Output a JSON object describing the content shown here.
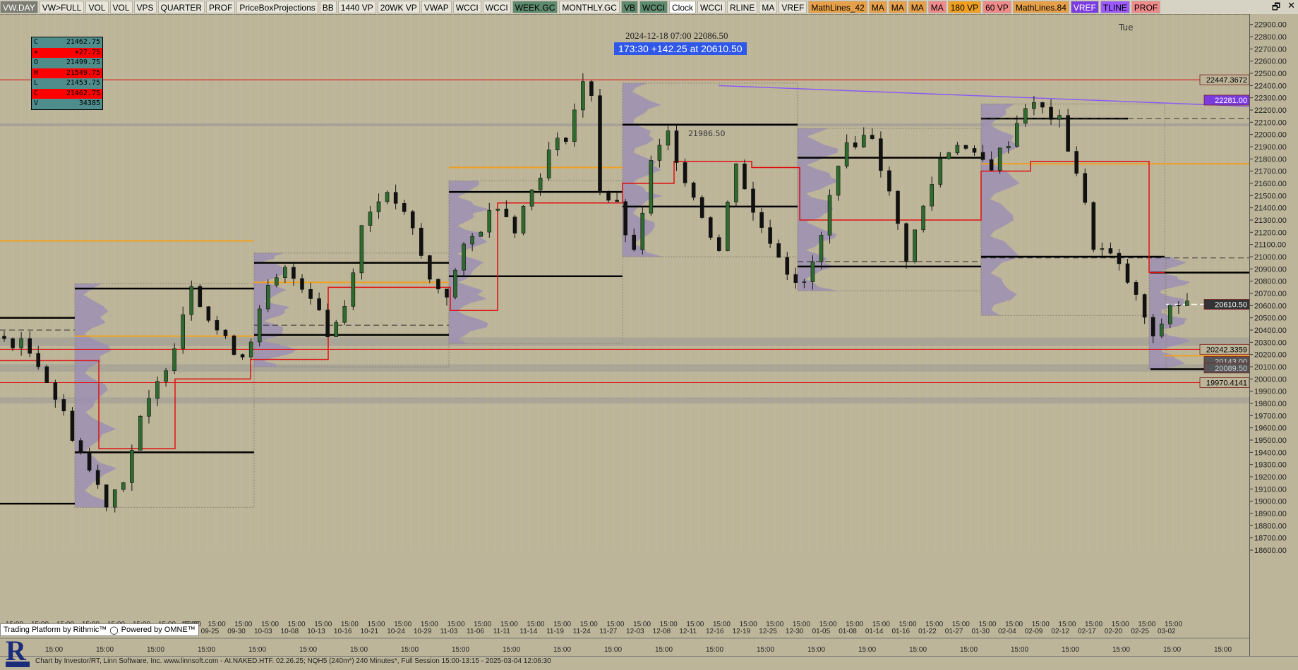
{
  "toolbar": {
    "buttons": [
      {
        "label": "VW.DAY",
        "bg": "#7d7d73",
        "fg": "#ffffff"
      },
      {
        "label": "VW>FULL",
        "bg": "#e8e5da",
        "fg": "#000000"
      },
      {
        "label": "VOL",
        "bg": "#e8e5da",
        "fg": "#000000"
      },
      {
        "label": "VOL",
        "bg": "#e8e5da",
        "fg": "#000000"
      },
      {
        "label": "VPS",
        "bg": "#e8e5da",
        "fg": "#000000"
      },
      {
        "label": "QUARTER",
        "bg": "#e8e5da",
        "fg": "#000000"
      },
      {
        "label": "PROF",
        "bg": "#e8e5da",
        "fg": "#000000"
      },
      {
        "label": "PriceBoxProjections",
        "bg": "#e8e5da",
        "fg": "#000000"
      },
      {
        "label": "BB",
        "bg": "#e8e5da",
        "fg": "#000000"
      },
      {
        "label": "1440 VP",
        "bg": "#e8e5da",
        "fg": "#000000"
      },
      {
        "label": "20WK VP",
        "bg": "#e8e5da",
        "fg": "#000000"
      },
      {
        "label": "VWAP",
        "bg": "#e8e5da",
        "fg": "#000000"
      },
      {
        "label": "WCCI",
        "bg": "#e8e5da",
        "fg": "#000000"
      },
      {
        "label": "WCCI",
        "bg": "#e8e5da",
        "fg": "#000000"
      },
      {
        "label": "WEEK.GC",
        "bg": "#5e8a6e",
        "fg": "#000000"
      },
      {
        "label": "MONTHLY.GC",
        "bg": "#e8e5da",
        "fg": "#000000"
      },
      {
        "label": "VB",
        "bg": "#5e8a6e",
        "fg": "#000000"
      },
      {
        "label": "WCCI",
        "bg": "#5e8a6e",
        "fg": "#000000"
      },
      {
        "label": "Clock",
        "bg": "#ffffff",
        "fg": "#000000"
      },
      {
        "label": "WCCI",
        "bg": "#e8e5da",
        "fg": "#000000"
      },
      {
        "label": "RLINE",
        "bg": "#e8e5da",
        "fg": "#000000"
      },
      {
        "label": "MA",
        "bg": "#e8e5da",
        "fg": "#000000"
      },
      {
        "label": "VREF",
        "bg": "#e8e5da",
        "fg": "#000000"
      },
      {
        "label": "MathLines_42",
        "bg": "#e7a04a",
        "fg": "#000000"
      },
      {
        "label": "MA",
        "bg": "#e7a04a",
        "fg": "#000000"
      },
      {
        "label": "MA",
        "bg": "#e7a04a",
        "fg": "#000000"
      },
      {
        "label": "MA",
        "bg": "#e7a04a",
        "fg": "#000000"
      },
      {
        "label": "MA",
        "bg": "#f08a8a",
        "fg": "#000000"
      },
      {
        "label": "180 VP",
        "bg": "#f0a020",
        "fg": "#000000"
      },
      {
        "label": "60 VP",
        "bg": "#f08a8a",
        "fg": "#000000"
      },
      {
        "label": "MathLines.84",
        "bg": "#e7a04a",
        "fg": "#000000"
      },
      {
        "label": "VREF",
        "bg": "#7a3be0",
        "fg": "#ffffff"
      },
      {
        "label": "TLINE",
        "bg": "#9b59ff",
        "fg": "#000000"
      },
      {
        "label": "PROF",
        "bg": "#f08a8a",
        "fg": "#000000"
      }
    ],
    "window_controls": {
      "restore": "🗗",
      "close": "✕"
    }
  },
  "ohlc_box": [
    {
      "key": "C",
      "value": "21462.75",
      "bg": "#4f8d8d"
    },
    {
      "key": "+",
      "value": "+27.75",
      "bg": "#ff0000"
    },
    {
      "key": "O",
      "value": "21499.75",
      "bg": "#4f8d8d"
    },
    {
      "key": "H",
      "value": "21549.75",
      "bg": "#ff0000"
    },
    {
      "key": "L",
      "value": "21453.75",
      "bg": "#4f8d8d"
    },
    {
      "key": "C",
      "value": "21462.75",
      "bg": "#ff0000"
    },
    {
      "key": "V",
      "value": "34385",
      "bg": "#4f8d8d"
    }
  ],
  "header": {
    "date_price": "2024-12-18 07:00  22086.50",
    "measure": "173:30  +142.25 at 20610.50",
    "day_label": "Tue",
    "inline_price_label": "21986.50"
  },
  "price_axis": {
    "ticks": [
      "22900.00",
      "22800.00",
      "22700.00",
      "22600.00",
      "22500.00",
      "22400.00",
      "22300.00",
      "22200.00",
      "22100.00",
      "22000.00",
      "21900.00",
      "21800.00",
      "21700.00",
      "21600.00",
      "21500.00",
      "21400.00",
      "21300.00",
      "21200.00",
      "21100.00",
      "21000.00",
      "20900.00",
      "20800.00",
      "20700.00",
      "20600.00",
      "20500.00",
      "20400.00",
      "20300.00",
      "20200.00",
      "20100.00",
      "20000.00",
      "19900.00",
      "19800.00",
      "19700.00",
      "19600.00",
      "19500.00",
      "19400.00",
      "19300.00",
      "19200.00",
      "19100.00",
      "19000.00",
      "18900.00",
      "18800.00",
      "18700.00",
      "18600.00"
    ],
    "min": 18600,
    "max": 22950,
    "tags": [
      {
        "label": "22447.3672",
        "price": 22447.37,
        "bg": "#bdb59a",
        "fg": "#000000"
      },
      {
        "label": "22281.00",
        "price": 22281.0,
        "bg": "#7a3be0",
        "fg": "#ffffff"
      },
      {
        "label": "20610.50",
        "price": 20610.5,
        "bg": "#333333",
        "fg": "#ffffff"
      },
      {
        "label": "20242.3359",
        "price": 20242.34,
        "bg": "#bdb59a",
        "fg": "#000000"
      },
      {
        "label": "20143.00",
        "price": 20143.0,
        "bg": "#555555",
        "fg": "#cccccc"
      },
      {
        "label": "20089.50",
        "price": 20089.5,
        "bg": "#555555",
        "fg": "#cccccc"
      },
      {
        "label": "19970.4141",
        "price": 19970.41,
        "bg": "#bdb59a",
        "fg": "#000000"
      }
    ]
  },
  "time_axis": {
    "date_labels": [
      "09-22",
      "09-25",
      "09-30",
      "10-03",
      "10-08",
      "10-13",
      "10-16",
      "10-21",
      "10-24",
      "10-29",
      "11-03",
      "11-06",
      "11-11",
      "11-14",
      "11-19",
      "11-24",
      "11-27",
      "12-03",
      "12-08",
      "12-11",
      "12-16",
      "12-19",
      "12-25",
      "12-30",
      "01-05",
      "01-08",
      "01-14",
      "01-16",
      "01-22",
      "01-27",
      "01-30",
      "02-04",
      "02-09",
      "02-12",
      "02-17",
      "02-20",
      "02-25",
      "03-02"
    ],
    "time_label": "15:00"
  },
  "footer": {
    "status": "Chart by Investor/RT, Linn Software, Inc. www.linnsoft.com - AI.NAKED.HTF.   02.26.25; NQH5 (240m*) 240 Minutes*, Full Session 15:00-13:15 - 2025-03-04 12:06:30",
    "badge_left": "Trading Platform by Rithmic™",
    "badge_right": "Powered by OMNE™"
  },
  "colors": {
    "background": "#bdb59a",
    "up_candle": "#2e6b2e",
    "down_candle": "#111111",
    "profile": "#9c8fb3",
    "poc_line": "#000000",
    "vwap_line": "#e01010",
    "value_area_line": "#f0a020",
    "trend_line": "#8a5cf0"
  },
  "chart_data": {
    "type": "candlestick",
    "symbol": "NQH5",
    "timeframe": "240 Minutes",
    "ylim": [
      18600,
      22950
    ],
    "path": [
      [
        0,
        20350
      ],
      [
        3,
        20280
      ],
      [
        5,
        20150
      ],
      [
        7,
        19850
      ],
      [
        9,
        19550
      ],
      [
        11,
        19250
      ],
      [
        13,
        19000
      ],
      [
        15,
        19200
      ],
      [
        17,
        19650
      ],
      [
        19,
        19950
      ],
      [
        21,
        20300
      ],
      [
        23,
        20800
      ],
      [
        25,
        20500
      ],
      [
        27,
        20300
      ],
      [
        29,
        20200
      ],
      [
        30,
        20350
      ],
      [
        32,
        20720
      ],
      [
        34,
        20880
      ],
      [
        36,
        20780
      ],
      [
        38,
        20600
      ],
      [
        39,
        20350
      ],
      [
        41,
        20600
      ],
      [
        43,
        21250
      ],
      [
        45,
        21500
      ],
      [
        47,
        21450
      ],
      [
        49,
        21200
      ],
      [
        51,
        20800
      ],
      [
        53,
        20700
      ],
      [
        55,
        21050
      ],
      [
        57,
        21250
      ],
      [
        59,
        21450
      ],
      [
        61,
        21250
      ],
      [
        63,
        21550
      ],
      [
        65,
        21850
      ],
      [
        67,
        22000
      ],
      [
        69,
        22400
      ],
      [
        70,
        22350
      ],
      [
        71,
        21550
      ],
      [
        73,
        21400
      ],
      [
        75,
        21000
      ],
      [
        77,
        21750
      ],
      [
        79,
        22000
      ],
      [
        81,
        21650
      ],
      [
        83,
        21350
      ],
      [
        85,
        21050
      ],
      [
        87,
        21800
      ],
      [
        89,
        21350
      ],
      [
        91,
        21150
      ],
      [
        93,
        20900
      ],
      [
        95,
        20750
      ],
      [
        97,
        21150
      ],
      [
        99,
        21800
      ],
      [
        101,
        21950
      ],
      [
        103,
        22000
      ],
      [
        105,
        21500
      ],
      [
        107,
        21000
      ],
      [
        109,
        21400
      ],
      [
        111,
        21800
      ],
      [
        113,
        21950
      ],
      [
        115,
        21800
      ],
      [
        117,
        21750
      ],
      [
        119,
        21950
      ],
      [
        121,
        22250
      ],
      [
        123,
        22200
      ],
      [
        125,
        22100
      ],
      [
        127,
        21700
      ],
      [
        129,
        21100
      ],
      [
        131,
        21000
      ],
      [
        133,
        20800
      ],
      [
        135,
        20500
      ],
      [
        136,
        20300
      ],
      [
        137,
        20460
      ],
      [
        138,
        20610
      ]
    ],
    "value_lines": [
      {
        "price": 22447.37,
        "color": "#e01010"
      },
      {
        "price": 19970.41,
        "color": "#e01010"
      },
      {
        "price": 20242.34,
        "color": "#e01010"
      }
    ]
  }
}
